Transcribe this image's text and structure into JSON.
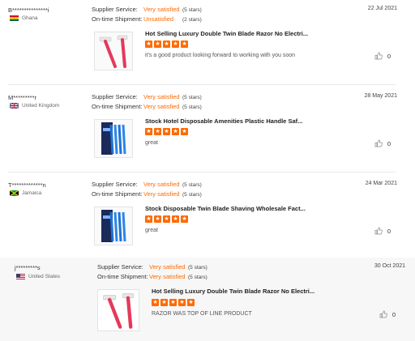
{
  "labels": {
    "supplier_service": "Supplier Service:",
    "ontime_shipment": "On-time Shipment:"
  },
  "colors": {
    "accent": "#ff6a00",
    "divider": "#eaeaea"
  },
  "reviews": [
    {
      "buyer": "B***************i",
      "country": "Ghana",
      "flag": "ghana",
      "supplier_service": {
        "value": "Very satisfied",
        "stars": "(5 stars)"
      },
      "ontime_shipment": {
        "value": "Unsatisfied",
        "stars": "(2 stars)"
      },
      "date": "22 Jul 2021",
      "product": "Hot Selling Luxury Double Twin Blade Razor No Electri...",
      "product_rating": 5,
      "comment": "it's a good product  looking forward to working with you soon",
      "likes": "0",
      "thumb": "pink-razor"
    },
    {
      "buyer": "M*********r",
      "country": "United Kingdom",
      "flag": "uk",
      "supplier_service": {
        "value": "Very satisfied",
        "stars": "(5 stars)"
      },
      "ontime_shipment": {
        "value": "Very satisfied",
        "stars": "(5 stars)"
      },
      "date": "28 May 2021",
      "product": "Stock Hotel Disposable Amenities Plastic Handle Saf...",
      "product_rating": 5,
      "comment": "great",
      "likes": "0",
      "thumb": "blue-razor-pack"
    },
    {
      "buyer": "T*************n",
      "country": "Jamaica",
      "flag": "jamaica",
      "supplier_service": {
        "value": "Very satisfied",
        "stars": "(5 stars)"
      },
      "ontime_shipment": {
        "value": "Very satisfied",
        "stars": "(5 stars)"
      },
      "date": "24 Mar 2021",
      "product": "Stock Disposable Twin Blade Shaving Wholesale Fact...",
      "product_rating": 5,
      "comment": "great",
      "likes": "0",
      "thumb": "blue-razor-pack"
    },
    {
      "buyer": "j*********s",
      "country": "United States",
      "flag": "us",
      "supplier_service": {
        "value": "Very satisfied",
        "stars": "(5 stars)"
      },
      "ontime_shipment": {
        "value": "Very satisfied",
        "stars": "(5 stars)"
      },
      "date": "30 Oct 2021",
      "product": "Hot Selling Luxury Double Twin Blade Razor No Electri...",
      "product_rating": 5,
      "comment": "RAZOR WAS TOP OF LINE PRODUCT",
      "likes": "0",
      "thumb": "pink-razor"
    }
  ]
}
